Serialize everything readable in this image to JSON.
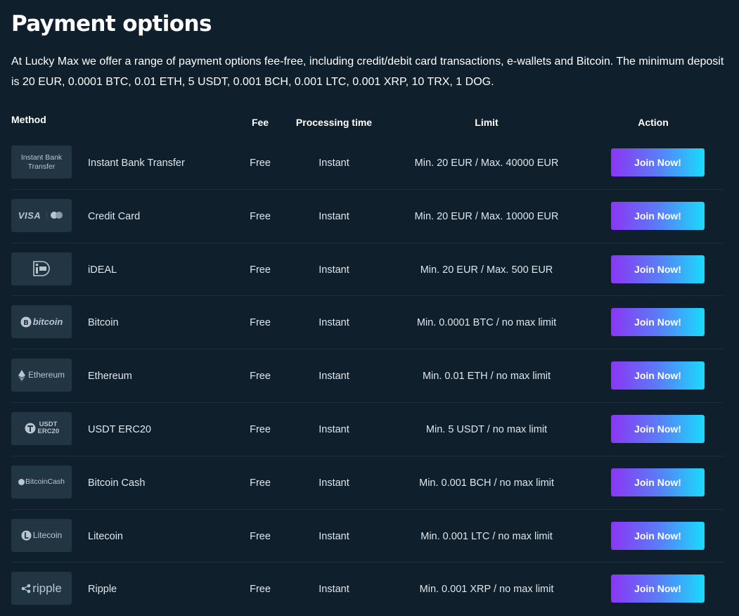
{
  "page": {
    "title": "Payment options",
    "intro": "At Lucky Max we offer a range of payment options fee-free, including credit/debit card transactions, e-wallets and Bitcoin. The minimum deposit is 20 EUR, 0.0001 BTC, 0.01 ETH, 5 USDT, 0.001 BCH, 0.001 LTC, 0.001 XRP, 10 TRX, 1 DOG."
  },
  "table": {
    "headers": {
      "method": "Method",
      "fee": "Fee",
      "processing": "Processing time",
      "limit": "Limit",
      "action": "Action"
    },
    "rows": [
      {
        "logo_icon": "instant-bank-transfer-logo",
        "logo_text": "Instant Bank Transfer",
        "name": "Instant Bank Transfer",
        "fee": "Free",
        "processing": "Instant",
        "limit": "Min. 20 EUR / Max. 40000 EUR",
        "action": "Join Now!"
      },
      {
        "logo_icon": "visa-mastercard-logo",
        "logo_text": "VISA",
        "name": "Credit Card",
        "fee": "Free",
        "processing": "Instant",
        "limit": "Min. 20 EUR / Max. 10000 EUR",
        "action": "Join Now!"
      },
      {
        "logo_icon": "ideal-logo",
        "logo_text": "iDEAL",
        "name": "iDEAL",
        "fee": "Free",
        "processing": "Instant",
        "limit": "Min. 20 EUR / Max. 500 EUR",
        "action": "Join Now!"
      },
      {
        "logo_icon": "bitcoin-logo",
        "logo_text": "bitcoin",
        "name": "Bitcoin",
        "fee": "Free",
        "processing": "Instant",
        "limit": "Min. 0.0001 BTC / no max limit",
        "action": "Join Now!"
      },
      {
        "logo_icon": "ethereum-logo",
        "logo_text": "Ethereum",
        "name": "Ethereum",
        "fee": "Free",
        "processing": "Instant",
        "limit": "Min. 0.01 ETH / no max limit",
        "action": "Join Now!"
      },
      {
        "logo_icon": "usdt-logo",
        "logo_text": "USDT ERC20",
        "name": "USDT ERC20",
        "fee": "Free",
        "processing": "Instant",
        "limit": "Min. 5 USDT / no max limit",
        "action": "Join Now!"
      },
      {
        "logo_icon": "bitcoin-cash-logo",
        "logo_text": "BitcoinCash",
        "name": "Bitcoin Cash",
        "fee": "Free",
        "processing": "Instant",
        "limit": "Min. 0.001 BCH / no max limit",
        "action": "Join Now!"
      },
      {
        "logo_icon": "litecoin-logo",
        "logo_text": "Litecoin",
        "name": "Litecoin",
        "fee": "Free",
        "processing": "Instant",
        "limit": "Min. 0.001 LTC / no max limit",
        "action": "Join Now!"
      },
      {
        "logo_icon": "ripple-logo",
        "logo_text": "ripple",
        "name": "Ripple",
        "fee": "Free",
        "processing": "Instant",
        "limit": "Min. 0.001 XRP / no max limit",
        "action": "Join Now!"
      }
    ]
  },
  "colors": {
    "background": "#0f1f2b",
    "logo_tile": "#223542",
    "button_gradient_start": "#8a36f4",
    "button_gradient_end": "#19dcfd"
  }
}
